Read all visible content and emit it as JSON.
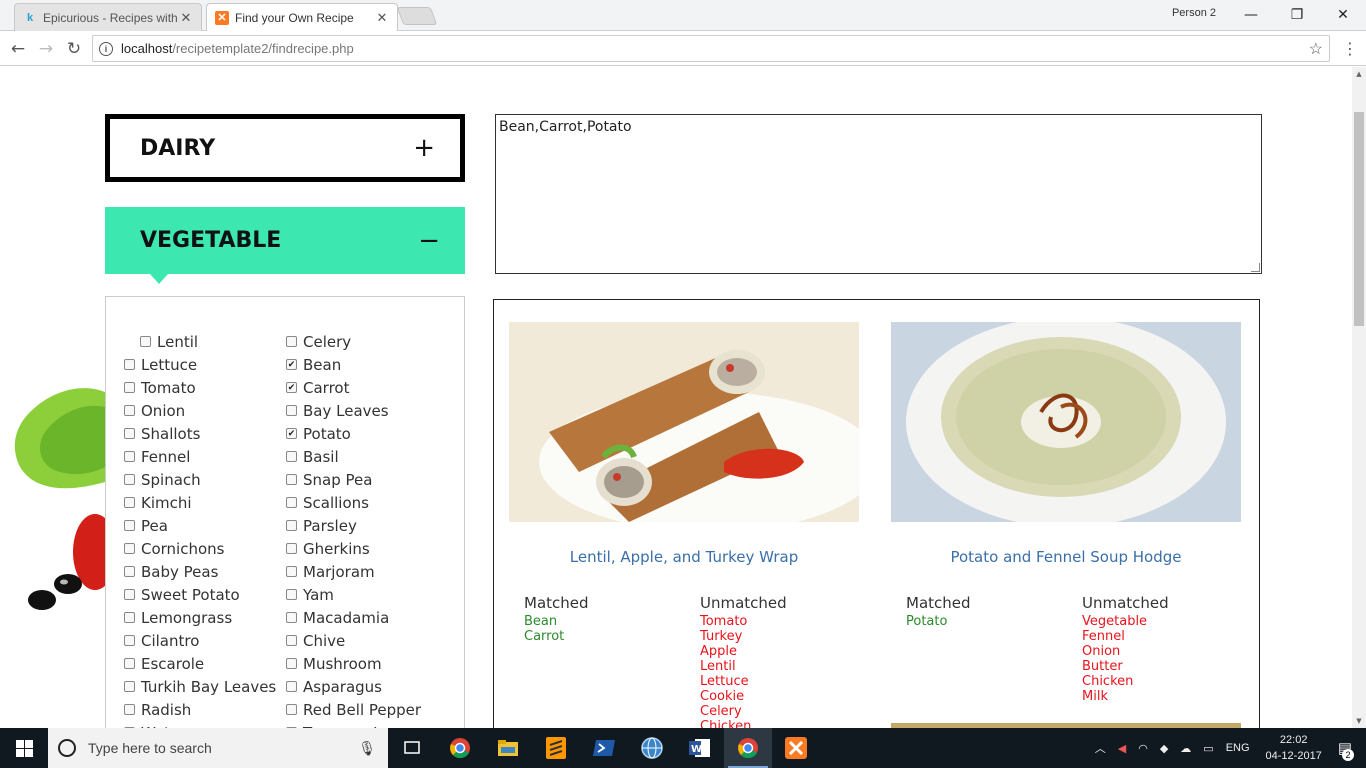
{
  "browser": {
    "tabs": [
      {
        "title": "Epicurious - Recipes with",
        "favicon": "k",
        "active": false
      },
      {
        "title": "Find your Own Recipe",
        "favicon": "xampp",
        "active": true
      }
    ],
    "profile": "Person 2",
    "url_host": "localhost",
    "url_path": "/recipetemplate2/findrecipe.php"
  },
  "categories": {
    "dairy": {
      "label": "DAIRY",
      "toggle": "+"
    },
    "vegetable": {
      "label": "VEGETABLE",
      "toggle": "−"
    }
  },
  "vegetables_col1": [
    {
      "name": "Lentil",
      "checked": false
    },
    {
      "name": "Lettuce",
      "checked": false
    },
    {
      "name": "Tomato",
      "checked": false
    },
    {
      "name": "Onion",
      "checked": false
    },
    {
      "name": "Shallots",
      "checked": false
    },
    {
      "name": "Fennel",
      "checked": false
    },
    {
      "name": "Spinach",
      "checked": false
    },
    {
      "name": "Kimchi",
      "checked": false
    },
    {
      "name": "Pea",
      "checked": false
    },
    {
      "name": "Cornichons",
      "checked": false
    },
    {
      "name": "Baby Peas",
      "checked": false
    },
    {
      "name": "Sweet Potato",
      "checked": false
    },
    {
      "name": "Lemongrass",
      "checked": false
    },
    {
      "name": "Cilantro",
      "checked": false
    },
    {
      "name": "Escarole",
      "checked": false
    },
    {
      "name": "Turkih Bay Leaves",
      "checked": false
    },
    {
      "name": "Radish",
      "checked": false
    },
    {
      "name": "Watercress",
      "checked": false
    }
  ],
  "vegetables_col2": [
    {
      "name": "Celery",
      "checked": false
    },
    {
      "name": "Bean",
      "checked": true
    },
    {
      "name": "Carrot",
      "checked": true
    },
    {
      "name": "Bay Leaves",
      "checked": false
    },
    {
      "name": "Potato",
      "checked": true
    },
    {
      "name": "Basil",
      "checked": false
    },
    {
      "name": "Snap Pea",
      "checked": false
    },
    {
      "name": "Scallions",
      "checked": false
    },
    {
      "name": "Parsley",
      "checked": false
    },
    {
      "name": "Gherkins",
      "checked": false
    },
    {
      "name": "Marjoram",
      "checked": false
    },
    {
      "name": "Yam",
      "checked": false
    },
    {
      "name": "Macadamia",
      "checked": false
    },
    {
      "name": "Chive",
      "checked": false
    },
    {
      "name": "Mushroom",
      "checked": false
    },
    {
      "name": "Asparagus",
      "checked": false
    },
    {
      "name": "Red Bell Pepper",
      "checked": false
    },
    {
      "name": "Tarragon Leaves",
      "checked": false
    }
  ],
  "selected_ingredients": "Bean,Carrot,Potato",
  "recipes": [
    {
      "title": "Lentil, Apple, and Turkey Wrap",
      "matched_label": "Matched",
      "unmatched_label": "Unmatched",
      "matched": [
        "Bean",
        "Carrot"
      ],
      "unmatched": [
        "Tomato",
        "Turkey",
        "Apple",
        "Lentil",
        "Lettuce",
        "Cookie",
        "Celery",
        "Chicken"
      ]
    },
    {
      "title": "Potato and Fennel Soup Hodge",
      "matched_label": "Matched",
      "unmatched_label": "Unmatched",
      "matched": [
        "Potato"
      ],
      "unmatched": [
        "Vegetable",
        "Fennel",
        "Onion",
        "Butter",
        "Chicken",
        "Milk"
      ]
    }
  ],
  "taskbar": {
    "search_placeholder": "Type here to search",
    "language": "ENG",
    "time": "22:02",
    "date": "04-12-2017",
    "notifications": "2"
  },
  "colors": {
    "vegetable_accent": "#3ce8b0",
    "matched": "#2b8a2b",
    "unmatched": "#e8141b",
    "recipe_title": "#3a6fa8"
  }
}
